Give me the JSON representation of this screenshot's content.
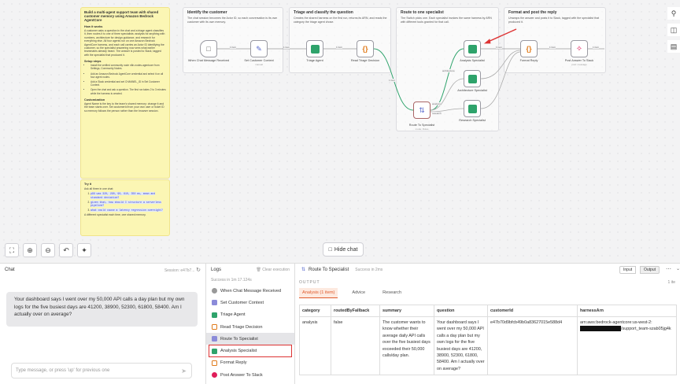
{
  "canvas": {
    "intro": {
      "title": "Build a multi-agent support team with shared customer memory using Amazon Bedrock AgentCore",
      "how_heading": "How it works",
      "how_text": "A customer asks a question in the chat and a triage agent classifies it, then routes it to one of three specialists: analysis for anything with numbers, architecture for design guidance, and research for everything else. All four agents run on one Amazon Bedrock AgentCore harness, and each call carries an Actor ID identifying the customer, so the specialist answering now sees what earlier teammates already heard. The answer is posted to Slack, tagged with the specialist that produced it.",
      "setup_heading": "Setup steps",
      "setup_steps": [
        "Install the verified community node n8n-nodes-agentcore from Settings, Community Nodes.",
        "Add an Amazon Bedrock AgentCore credential and select it on all four agent nodes.",
        "Add a Slack credential and set CHANNEL_ID in Set Customer Context.",
        "Open the chat and ask a question. The first run takes 2 to 3 minutes while the harness is created."
      ],
      "custom_heading": "Customization",
      "custom_text": "Agent Name is the key to the team's shared memory: change it and the team starts over. Set customerId from your own user or ticket ID so memory follows the person rather than the browser session."
    },
    "tryit": {
      "heading": "Try it",
      "intro": "Ask all three in one chat:",
      "items": [
        "p99 was 320, 290, 90, 610, 350 ms, mean and standard deviation?",
        "given that, how should I structure a serverless pipeline?",
        "what could cause a latency regression overnight?"
      ],
      "footer": "A different specialist each time, one shared memory."
    },
    "groups": [
      {
        "title": "Identify the customer",
        "desc": "The chat session becomes the Actor ID, so each conversation is its own customer with its own memory."
      },
      {
        "title": "Triage and classify the question",
        "desc": "Creates the shared harness on the first run, returns its ARN, and reads the category the triage agent chose."
      },
      {
        "title": "Route to one specialist",
        "desc": "The Switch picks one. Each specialist invokes the same harness by ARN with different tools granted for that call."
      },
      {
        "title": "Format and post the reply",
        "desc": "Unwraps the answer and posts it to Slack, tagged with the specialist that produced it."
      }
    ],
    "nodes": {
      "chat_trigger": "When Chat Message Received",
      "set_context": "Set Customer Context",
      "set_context_sub": "manual",
      "triage": "Triage Agent",
      "read_triage": "Read Triage Decision",
      "analysis": "Analysis Specialist",
      "architecture": "Architecture Specialist",
      "research": "Research Specialist",
      "route": "Route To Specialist",
      "route_sub": "mode: Rules",
      "format": "Format Reply",
      "slack": "Post Answer To Slack",
      "slack_sub": "post: message"
    },
    "edge_labels": {
      "item": "1 item",
      "analysis": "analysis",
      "architecture": "architecture",
      "research": "research"
    },
    "hide_chat": "Hide chat"
  },
  "chat": {
    "title": "Chat",
    "session": "Session: e47b7...",
    "message": "Your dashboard says I went over my 50,000 API calls a day plan but my own logs for the five busiest days are 41200, 38900, 52300, 61800, 58400. Am I actually over on average?",
    "placeholder": "Type message, or press 'up' for previous one"
  },
  "logs": {
    "title": "Logs",
    "clear": "Clear execution",
    "success": "Success in 1m 17.124s",
    "items": [
      {
        "label": "When Chat Message Received",
        "icon": "chat-icon"
      },
      {
        "label": "Set Customer Context",
        "icon": "edit-icon"
      },
      {
        "label": "Triage Agent",
        "icon": "agentcore-icon"
      },
      {
        "label": "Read Triage Decision",
        "icon": "code-icon"
      },
      {
        "label": "Route To Specialist",
        "icon": "switch-icon"
      },
      {
        "label": "Analysis Specialist",
        "icon": "agentcore-icon"
      },
      {
        "label": "Format Reply",
        "icon": "code-icon"
      },
      {
        "label": "Post Answer To Slack",
        "icon": "slack-icon"
      }
    ]
  },
  "output": {
    "node_title": "Route To Specialist",
    "status": "Success in 2ms",
    "input_label": "Input",
    "output_label": "Output",
    "section_label": "OUTPUT",
    "count": "1 ite",
    "tabs": [
      "Analysis (1 item)",
      "Advice",
      "Research"
    ],
    "columns": [
      "category",
      "routedByFallback",
      "summary",
      "question",
      "customerId",
      "harnessArn"
    ],
    "row": {
      "category": "analysis",
      "routedByFallback": "false",
      "summary": "The customer wants to know whether their average daily API calls over the five busiest days exceeded their 50,000 calls/day plan.",
      "question": "Your dashboard says I went over my 50,000 API calls a day plan but my own logs for the five busiest days are 41200, 38900, 52300, 61800, 58400. Am I actually over on average?",
      "customerId": "e47b70d9bfcb49b0a83627015e588d4",
      "harnessArn_a": "arn:aws:bedrock-agentcore:us-west-2:",
      "harnessArn_b": "/support_team-szab05jg4k"
    }
  },
  "colors": {
    "accent": "#e05a2b",
    "agent_green": "#2ea36b",
    "code_orange": "#e07a1a",
    "highlight_red": "#dd3333",
    "sticky": "#fbf6b4"
  }
}
